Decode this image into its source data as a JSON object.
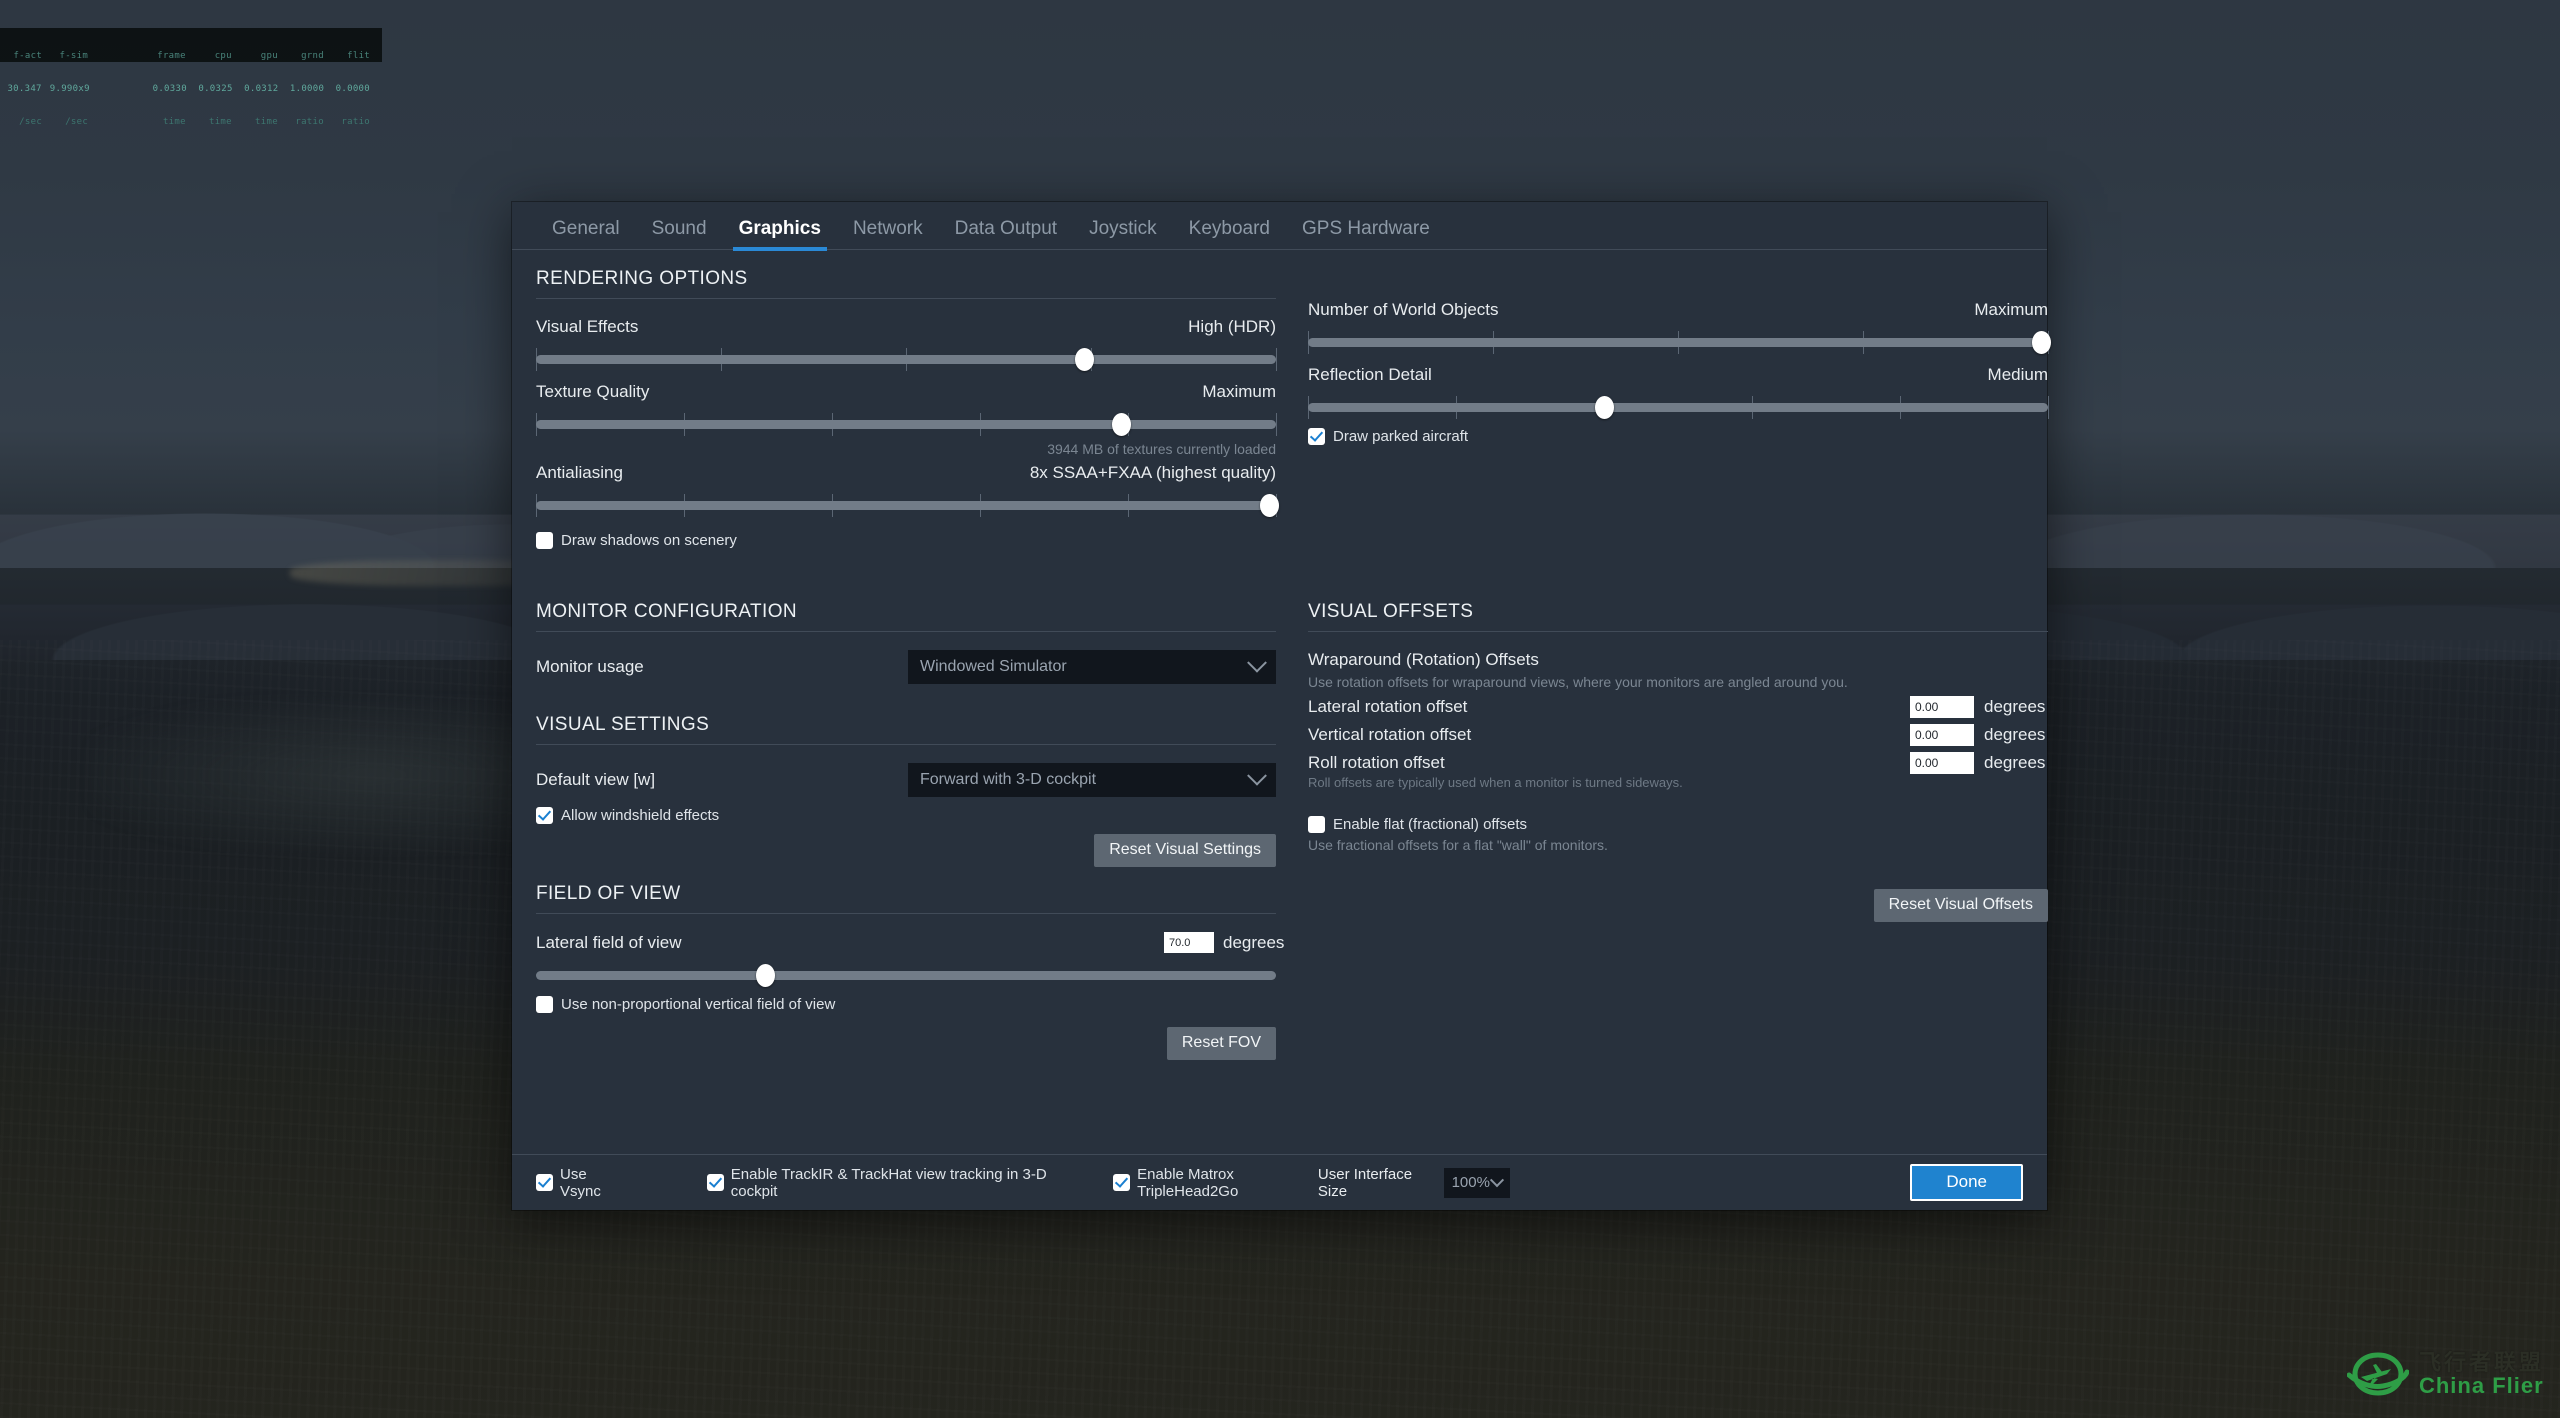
{
  "hud": {
    "columns": [
      {
        "label": "f-act",
        "value": "30.347",
        "unit": "/sec"
      },
      {
        "label": "f-sim",
        "value": "9.990x9",
        "unit": "/sec"
      },
      {
        "label": "",
        "value": "",
        "unit": ""
      },
      {
        "label": "frame",
        "value": "0.0330",
        "unit": "time"
      },
      {
        "label": "cpu",
        "value": "0.0325",
        "unit": "time"
      },
      {
        "label": "gpu",
        "value": "0.0312",
        "unit": "time"
      },
      {
        "label": "grnd",
        "value": "1.0000",
        "unit": "ratio"
      },
      {
        "label": "flit",
        "value": "0.0000",
        "unit": "ratio"
      }
    ]
  },
  "tabs": [
    {
      "label": "General",
      "active": false
    },
    {
      "label": "Sound",
      "active": false
    },
    {
      "label": "Graphics",
      "active": true
    },
    {
      "label": "Network",
      "active": false
    },
    {
      "label": "Data Output",
      "active": false
    },
    {
      "label": "Joystick",
      "active": false
    },
    {
      "label": "Keyboard",
      "active": false
    },
    {
      "label": "GPS Hardware",
      "active": false
    }
  ],
  "rendering": {
    "title": "RENDERING OPTIONS",
    "visual_effects": {
      "label": "Visual Effects",
      "value": "High (HDR)",
      "percent": 74,
      "ticks": 4
    },
    "texture_quality": {
      "label": "Texture Quality",
      "value": "Maximum",
      "percent": 79,
      "ticks": 5,
      "note": "3944 MB of textures currently loaded"
    },
    "antialiasing": {
      "label": "Antialiasing",
      "value": "8x SSAA+FXAA (highest quality)",
      "percent": 99,
      "ticks": 5
    },
    "world_objects": {
      "label": "Number of World Objects",
      "value": "Maximum",
      "percent": 99,
      "ticks": 4
    },
    "reflection_detail": {
      "label": "Reflection Detail",
      "value": "Medium",
      "percent": 40,
      "ticks": 5
    },
    "draw_shadows": {
      "label": "Draw shadows on scenery",
      "checked": false
    },
    "draw_parked": {
      "label": "Draw parked aircraft",
      "checked": true
    }
  },
  "monitor": {
    "title": "MONITOR CONFIGURATION",
    "usage_label": "Monitor usage",
    "usage_value": "Windowed Simulator"
  },
  "visual_settings": {
    "title": "VISUAL SETTINGS",
    "default_view_label": "Default view [w]",
    "default_view_value": "Forward with 3-D cockpit",
    "windshield": {
      "label": "Allow windshield effects",
      "checked": true
    },
    "reset_label": "Reset Visual Settings"
  },
  "fov": {
    "title": "FIELD OF VIEW",
    "lateral_label": "Lateral field of view",
    "lateral_value": "70.0",
    "unit": "degrees",
    "percent": 31,
    "nonproportional": {
      "label": "Use non-proportional vertical field of view",
      "checked": false
    },
    "reset_label": "Reset FOV"
  },
  "visual_offsets": {
    "title": "VISUAL OFFSETS",
    "wraparound_title": "Wraparound (Rotation) Offsets",
    "wraparound_desc": "Use rotation offsets for wraparound views, where your monitors are angled around you.",
    "rows": [
      {
        "label": "Lateral rotation offset",
        "value": "0.00",
        "unit": "degrees"
      },
      {
        "label": "Vertical rotation offset",
        "value": "0.00",
        "unit": "degrees"
      },
      {
        "label": "Roll rotation offset",
        "value": "0.00",
        "unit": "degrees"
      }
    ],
    "roll_note": "Roll offsets are typically used when a monitor is turned sideways.",
    "flat": {
      "label": "Enable flat (fractional) offsets",
      "checked": false
    },
    "flat_desc": "Use fractional offsets for a flat \"wall\" of monitors.",
    "reset_label": "Reset Visual Offsets"
  },
  "footer": {
    "vsync": {
      "label": "Use Vsync",
      "checked": true
    },
    "trackir": {
      "label": "Enable TrackIR & TrackHat view tracking in 3-D cockpit",
      "checked": true
    },
    "matrox": {
      "label": "Enable Matrox TripleHead2Go",
      "checked": true
    },
    "uisize_label": "User Interface Size",
    "uisize_value": "100%",
    "done_label": "Done"
  },
  "watermark": {
    "cn": "飞行者联盟",
    "en": "China Flier",
    "color": "#2fa84a"
  },
  "colors": {
    "accent": "#2a89d6",
    "panel": "#28313d",
    "track": "#727c88",
    "done": "#1f83cf"
  }
}
